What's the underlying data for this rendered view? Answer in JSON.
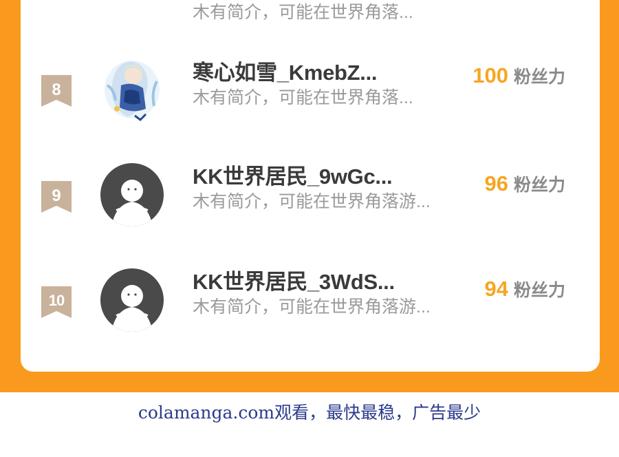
{
  "partial_row": {
    "intro": "木有简介，可能在世界角落..."
  },
  "rows": [
    {
      "rank": "8",
      "name": "寒心如雪_KmebZ...",
      "intro": "木有简介，可能在世界角落...",
      "fans_count": "100",
      "fans_unit": "粉丝力",
      "avatar": "anime-art"
    },
    {
      "rank": "9",
      "name": "KK世界居民_9wGc...",
      "intro": "木有简介，可能在世界角落游...",
      "fans_count": "96",
      "fans_unit": "粉丝力",
      "avatar": "default-user-icon"
    },
    {
      "rank": "10",
      "name": "KK世界居民_3WdS...",
      "intro": "木有简介，可能在世界角落游...",
      "fans_count": "94",
      "fans_unit": "粉丝力",
      "avatar": "default-user-icon"
    }
  ],
  "footer": {
    "text": "colamanga.com观看，最快最稳，广告最少"
  },
  "colors": {
    "frame": "#f99a1f",
    "fans_count": "#f5a623",
    "rank_badge": "#c9b29b",
    "footer_text": "#2a3a8c"
  }
}
